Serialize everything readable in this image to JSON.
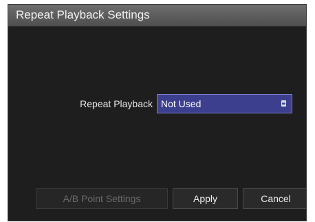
{
  "dialog": {
    "title": "Repeat Playback Settings"
  },
  "repeat_playback": {
    "label": "Repeat Playback",
    "selected_value": "Not Used",
    "icon": "dropdown-list-icon",
    "accent_color": "#3c3f8e"
  },
  "buttons": {
    "ab_point_settings": "A/B Point Settings",
    "ab_point_settings_enabled": false,
    "apply": "Apply",
    "cancel": "Cancel"
  }
}
